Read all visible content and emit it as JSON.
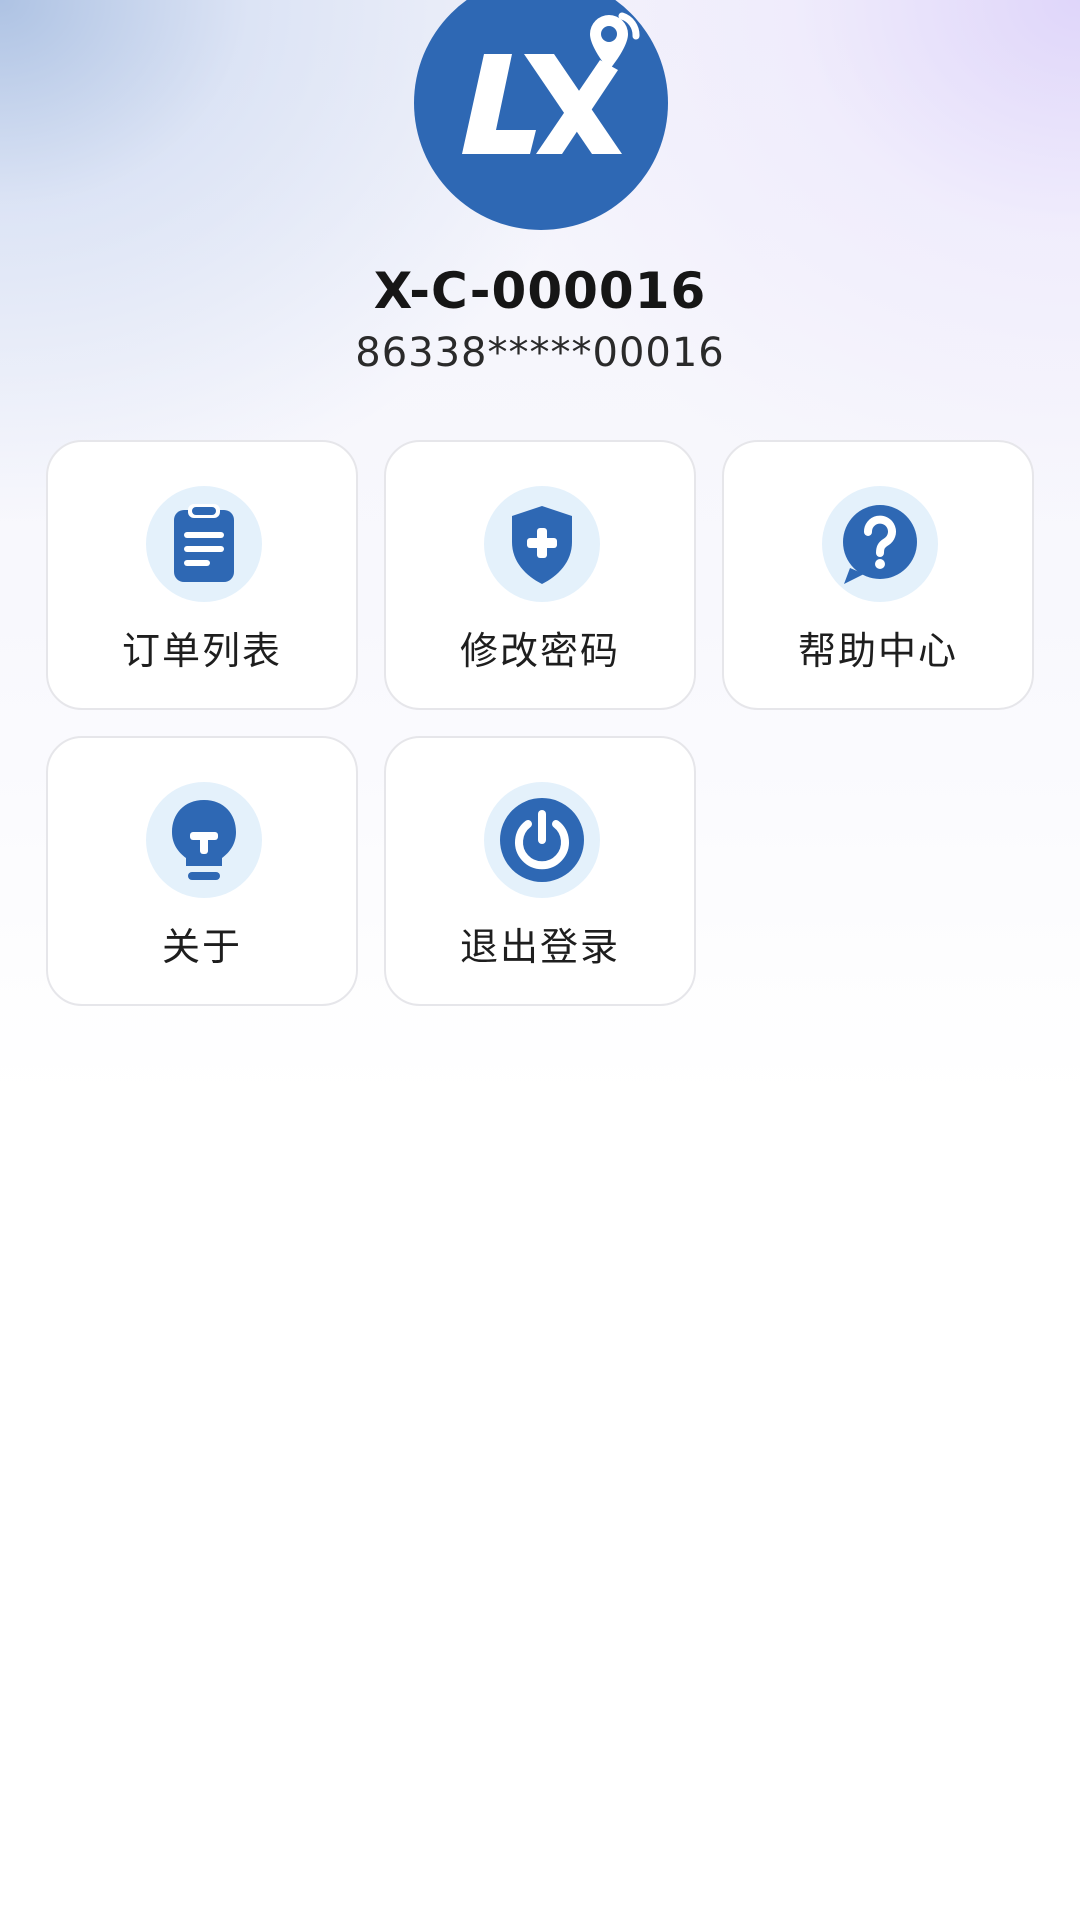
{
  "profile": {
    "logo_text": "LX",
    "username": "X-C-000016",
    "phone": "86338*****00016"
  },
  "menu": [
    {
      "label": "订单列表",
      "icon": "clipboard-list-icon"
    },
    {
      "label": "修改密码",
      "icon": "shield-plus-icon"
    },
    {
      "label": "帮助中心",
      "icon": "help-bubble-icon"
    },
    {
      "label": "关于",
      "icon": "lightbulb-icon"
    },
    {
      "label": "退出登录",
      "icon": "power-icon"
    }
  ],
  "colors": {
    "brand": "#2e68b4",
    "icon_bg": "#e4f1fb",
    "card_border": "#e6e6ea"
  }
}
